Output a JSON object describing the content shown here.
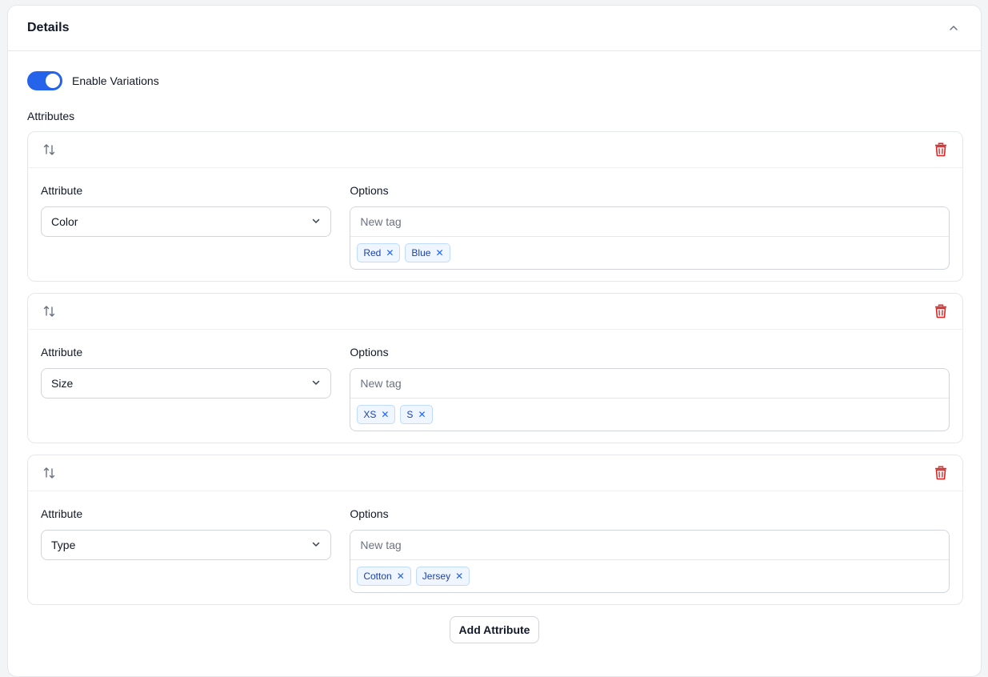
{
  "panel": {
    "title": "Details"
  },
  "variations": {
    "label": "Enable Variations",
    "enabled": true
  },
  "attributes_section": {
    "label": "Attributes"
  },
  "attributes": [
    {
      "attribute_label": "Attribute",
      "attribute_value": "Color",
      "options_label": "Options",
      "placeholder": "New tag",
      "tags": [
        "Red",
        "Blue"
      ]
    },
    {
      "attribute_label": "Attribute",
      "attribute_value": "Size",
      "options_label": "Options",
      "placeholder": "New tag",
      "tags": [
        "XS",
        "S"
      ]
    },
    {
      "attribute_label": "Attribute",
      "attribute_value": "Type",
      "options_label": "Options",
      "placeholder": "New tag",
      "tags": [
        "Cotton",
        "Jersey"
      ]
    }
  ],
  "actions": {
    "add_attribute": "Add Attribute"
  },
  "icons": {
    "collapse": "chevron-up-icon",
    "reorder": "arrows-up-down-icon",
    "delete": "trash-icon",
    "select": "chevron-down-icon",
    "remove_tag": "close-icon"
  },
  "colors": {
    "accent": "#2563eb",
    "danger": "#dc2626",
    "tag_bg": "#eff6ff",
    "tag_text": "#1e40af"
  }
}
